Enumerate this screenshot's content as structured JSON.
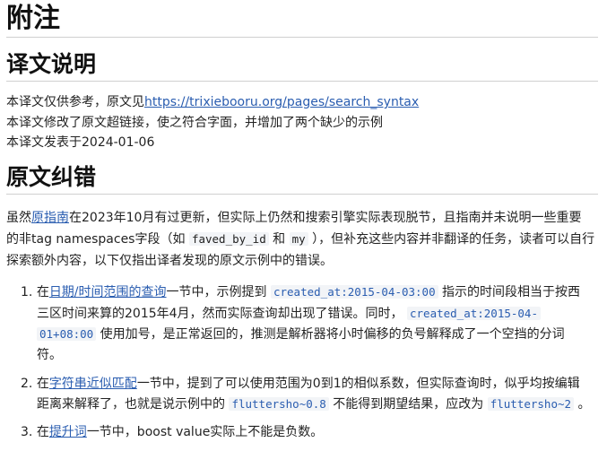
{
  "title": "附注",
  "translation_note": {
    "heading": "译文说明",
    "line1_prefix": "本译文仅供参考，原文见",
    "line1_link": "https://trixiebooru.org/pages/search_syntax",
    "line2": "本译文修改了原文超链接，使之符合字面，并增加了两个缺少的示例",
    "line3": "本译文发表于2024-01-06"
  },
  "errata": {
    "heading": "原文纠错",
    "p1_a": "虽然",
    "p1_link": "原指南",
    "p1_b": "在2023年10月有过更新，但实际上仍然和搜索引擎实际表现脱节，且指南并未说明一些重要",
    "p2_a": "的非tag namespaces字段（如 ",
    "p2_code1": "faved_by_id",
    "p2_b": " 和 ",
    "p2_code2": "my",
    "p2_c": " ），但补充这些内容并非翻译的任务，读者可以自行",
    "p3": "探索额外内容，以下仅指出译者发现的原文示例中的错误。",
    "items": [
      {
        "num": "1.",
        "l1_a": "在",
        "l1_link": "日期/时间范围的查询",
        "l1_b": "一节中，示例提到 ",
        "l1_code": "created_at:2015-04-03:00",
        "l1_c": " 指示的时间段相当于按西",
        "l2_a": "三区时间来算的2015年4月，然而实际查询却出现了错误。同时， ",
        "l2_code": "created_at:2015-04-",
        "l3_code": "01+08:00",
        "l3_a": " 使用加号，是正常返回的，推测是解析器将小时偏移的负号解释成了一个空挡的分词",
        "l4": "符。"
      },
      {
        "num": "2.",
        "l1_a": "在",
        "l1_link": "字符串近似匹配",
        "l1_b": "一节中，提到了可以使用范围为0到1的相似系数，但实际查询时，似乎均按编辑",
        "l2_a": "距离来解释了，也就是说示例中的 ",
        "l2_code1": "fluttersho~0.8",
        "l2_b": " 不能得到期望结果，应改为 ",
        "l2_code2": "fluttersho~2",
        "l2_c": " 。"
      },
      {
        "num": "3.",
        "l1_a": "在",
        "l1_link": "提升词",
        "l1_b": "一节中，boost value实际上不能是负数。"
      }
    ]
  }
}
